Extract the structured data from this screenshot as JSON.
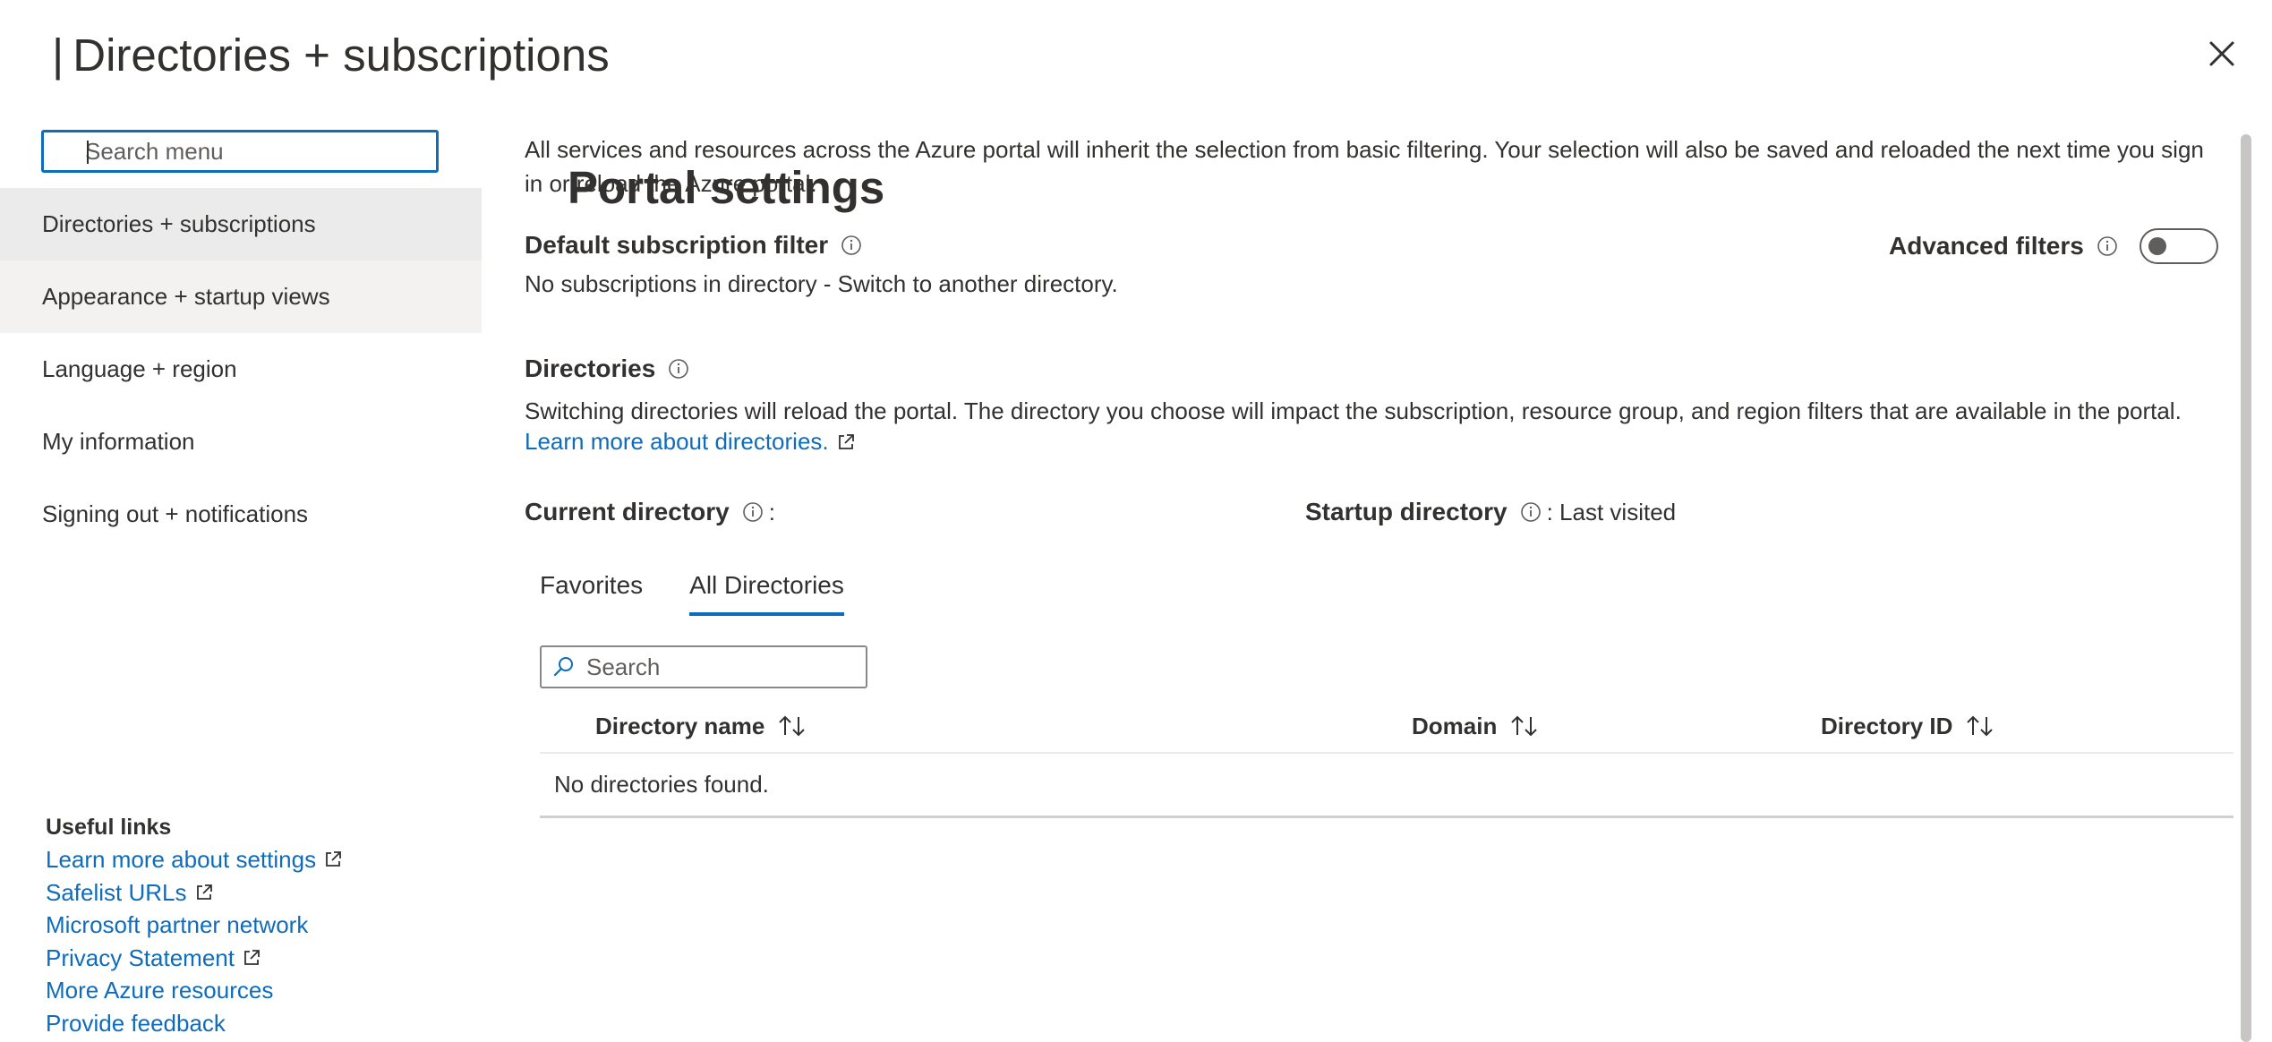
{
  "header": {
    "title_main": "Portal settings",
    "title_sep": "|",
    "title_sub": "Directories + subscriptions"
  },
  "sidebar": {
    "search_placeholder": "Search menu",
    "items": [
      {
        "label": "Directories + subscriptions"
      },
      {
        "label": "Appearance + startup views"
      },
      {
        "label": "Language + region"
      },
      {
        "label": "My information"
      },
      {
        "label": "Signing out + notifications"
      }
    ],
    "useful_links": {
      "header": "Useful links",
      "links": [
        {
          "label": "Learn more about settings"
        },
        {
          "label": "Safelist URLs"
        },
        {
          "label": "Microsoft partner network"
        },
        {
          "label": "Privacy Statement"
        },
        {
          "label": "More Azure resources"
        },
        {
          "label": "Provide feedback"
        }
      ]
    }
  },
  "main": {
    "intro": "All services and resources across the Azure portal will inherit the selection from basic filtering. Your selection will also be saved and reloaded the next time you sign in or reload the Azure portal.",
    "default_filter": {
      "title": "Default subscription filter",
      "text": "No subscriptions in directory - Switch to another directory."
    },
    "advanced_filters": {
      "label": "Advanced filters",
      "enabled": false
    },
    "directories": {
      "title": "Directories",
      "text": "Switching directories will reload the portal. The directory you choose will impact the subscription, resource group, and region filters that are available in the portal.",
      "link": "Learn more about directories."
    },
    "current_directory": {
      "label": "Current directory",
      "value": ":"
    },
    "startup_directory": {
      "label": "Startup directory",
      "value": ": Last visited"
    },
    "tabs": [
      {
        "label": "Favorites"
      },
      {
        "label": "All Directories"
      }
    ],
    "search_placeholder": "Search",
    "table": {
      "columns": [
        "Directory name",
        "Domain",
        "Directory ID"
      ],
      "empty": "No directories found."
    }
  },
  "colors": {
    "accent": "#0f6cbd",
    "text": "#323130",
    "selected_nav": "#ebebeb"
  }
}
